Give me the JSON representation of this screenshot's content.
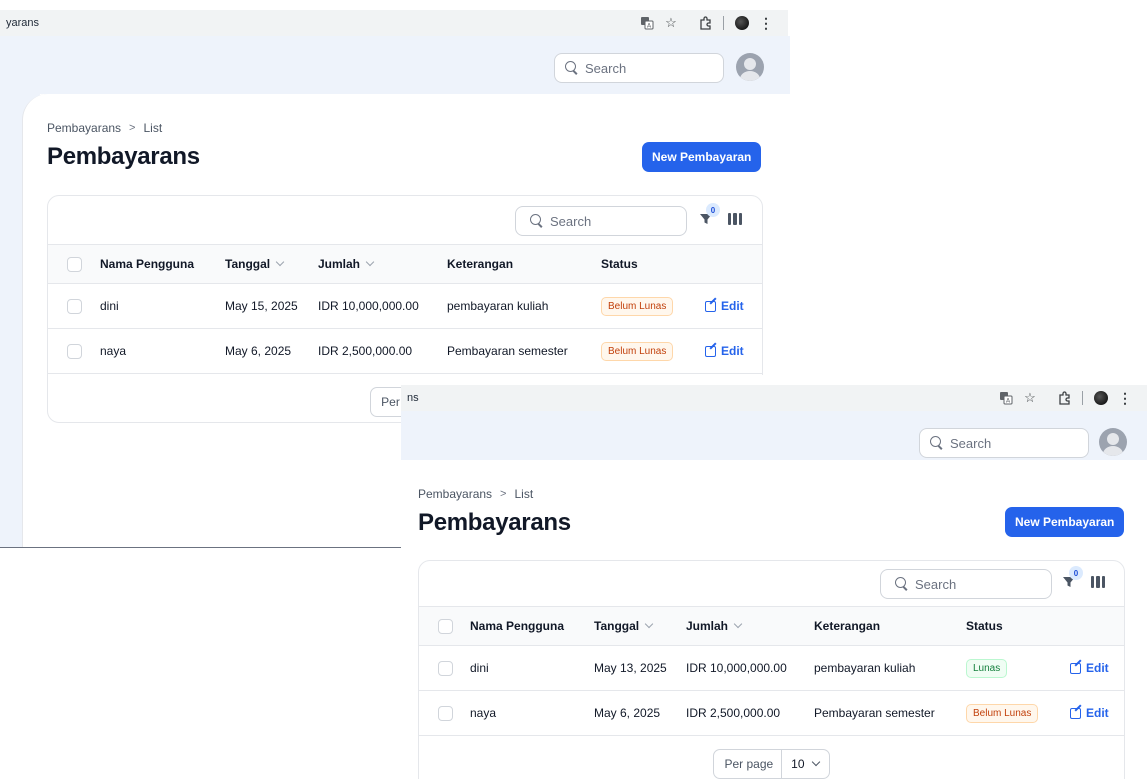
{
  "back": {
    "tab_title": "yarans",
    "top_search_placeholder": "Search",
    "breadcrumb": [
      "Pembayarans",
      "List"
    ],
    "page_title": "Pembayarans",
    "new_button": "New Pembayaran",
    "table_search_placeholder": "Search",
    "filter_count": "0",
    "columns": [
      "Nama Pengguna",
      "Tanggal",
      "Jumlah",
      "Keterangan",
      "Status"
    ],
    "rows": [
      {
        "nama": "dini",
        "tanggal": "May 15, 2025",
        "jumlah": "IDR 10,000,000.00",
        "keterangan": "pembayaran kuliah",
        "status": "Belum Lunas",
        "action": "Edit"
      },
      {
        "nama": "naya",
        "tanggal": "May 6, 2025",
        "jumlah": "IDR 2,500,000.00",
        "keterangan": "Pembayaran semester",
        "status": "Belum Lunas",
        "action": "Edit"
      }
    ],
    "per_page_label": "Per page"
  },
  "front": {
    "tab_title": "ns",
    "top_search_placeholder": "Search",
    "breadcrumb": [
      "Pembayarans",
      "List"
    ],
    "page_title": "Pembayarans",
    "new_button": "New Pembayaran",
    "table_search_placeholder": "Search",
    "filter_count": "0",
    "columns": [
      "Nama Pengguna",
      "Tanggal",
      "Jumlah",
      "Keterangan",
      "Status"
    ],
    "rows": [
      {
        "nama": "dini",
        "tanggal": "May 13, 2025",
        "jumlah": "IDR 10,000,000.00",
        "keterangan": "pembayaran kuliah",
        "status": "Lunas",
        "action": "Edit"
      },
      {
        "nama": "naya",
        "tanggal": "May 6, 2025",
        "jumlah": "IDR 2,500,000.00",
        "keterangan": "Pembayaran semester",
        "status": "Belum Lunas",
        "action": "Edit"
      }
    ],
    "per_page_label": "Per page",
    "per_page_value": "10"
  },
  "colors": {
    "primary": "#2563eb",
    "topbar": "#eef3fb",
    "warning_text": "#c2410c",
    "success_text": "#15803d"
  },
  "icons": [
    "translate-icon",
    "star-icon",
    "extensions-icon",
    "profile-icon",
    "more-icon",
    "search-icon",
    "filter-icon",
    "columns-icon",
    "edit-icon",
    "chevron-down-icon",
    "avatar"
  ]
}
